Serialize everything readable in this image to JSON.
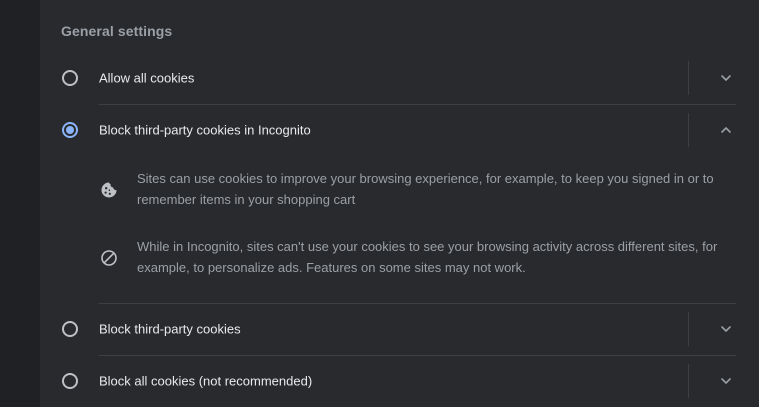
{
  "section": {
    "title": "General settings"
  },
  "options": [
    {
      "label": "Allow all cookies",
      "selected": false,
      "expanded": false
    },
    {
      "label": "Block third-party cookies in Incognito",
      "selected": true,
      "expanded": true
    },
    {
      "label": "Block third-party cookies",
      "selected": false,
      "expanded": false
    },
    {
      "label": "Block all cookies (not recommended)",
      "selected": false,
      "expanded": false
    }
  ],
  "details": [
    {
      "icon": "cookie-icon",
      "text": "Sites can use cookies to improve your browsing experience, for example, to keep you signed in or to remember items in your shopping cart"
    },
    {
      "icon": "block-icon",
      "text": "While in Incognito, sites can't use your cookies to see your browsing activity across different sites, for example, to personalize ads. Features on some sites may not work."
    }
  ],
  "colors": {
    "background": "#202124",
    "card": "#292a2d",
    "accent": "#8ab4f8",
    "text_primary": "#e8eaed",
    "text_secondary": "#9aa0a6",
    "divider": "#3c4043"
  }
}
